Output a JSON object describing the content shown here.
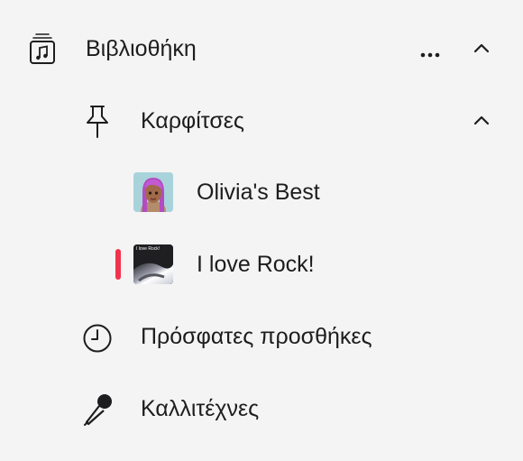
{
  "sidebar": {
    "library": {
      "label": "Βιβλιοθήκη",
      "icon": "music-library-icon",
      "more_icon": "ellipsis-icon",
      "chevron_icon": "chevron-up-icon"
    },
    "pins": {
      "label": "Καρφίτσες",
      "icon": "pin-icon",
      "chevron_icon": "chevron-up-icon"
    },
    "playlists": [
      {
        "label": "Olivia's Best",
        "artwork": "memoji-avatar-artwork"
      },
      {
        "label": "I love Rock!",
        "artwork_text": "I love Rock!",
        "now_playing": true
      }
    ],
    "recent": {
      "label": "Πρόσφατες προσθήκες",
      "icon": "clock-icon"
    },
    "artists": {
      "label": "Καλλιτέχνες",
      "icon": "microphone-icon"
    }
  },
  "colors": {
    "background": "#f4f4f4",
    "text": "#1d1d1f",
    "accent": "#f2334e"
  }
}
